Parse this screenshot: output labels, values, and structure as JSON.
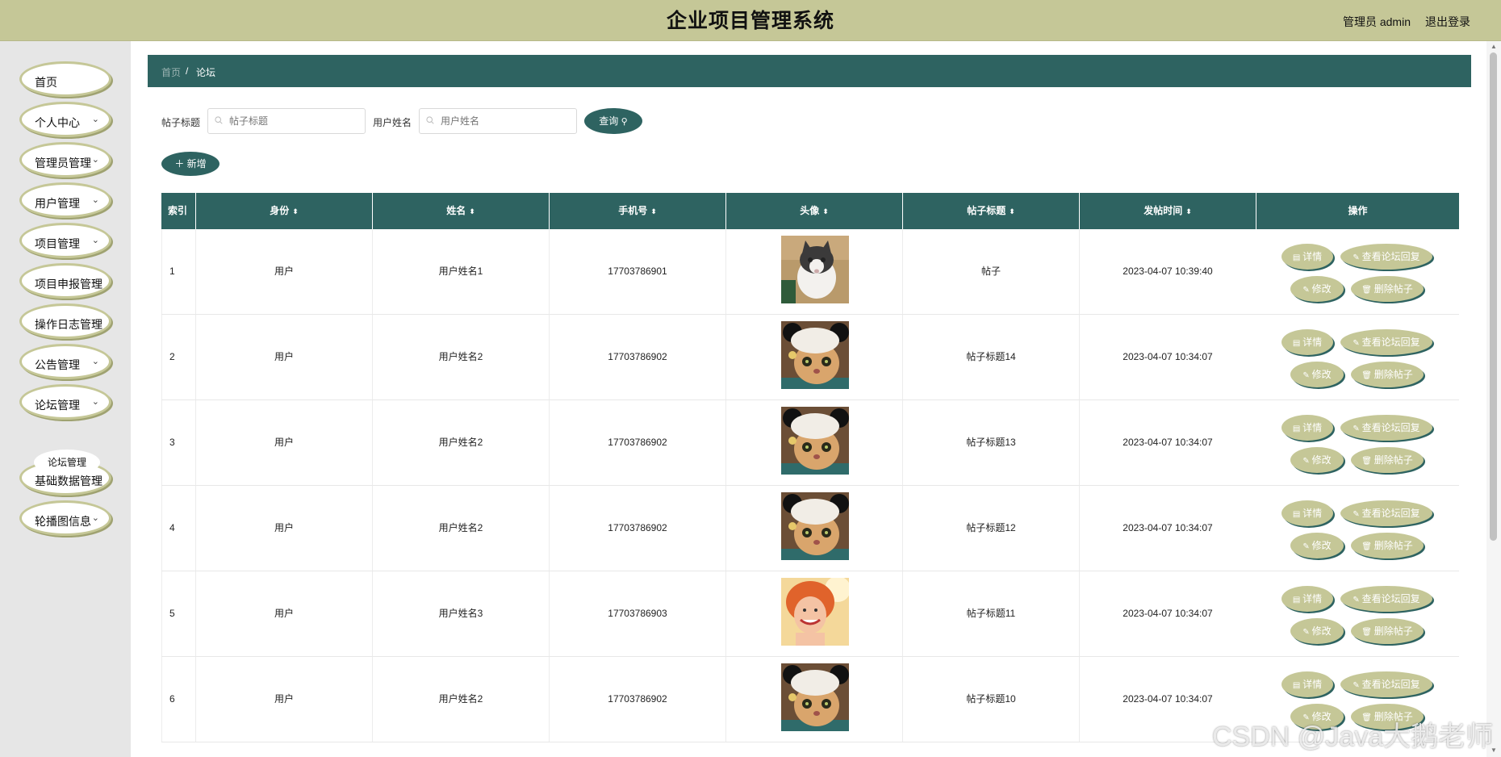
{
  "header": {
    "title": "企业项目管理系统",
    "user_label": "管理员 admin",
    "logout_label": "退出登录",
    "accent": "#c5c797",
    "brand": "#2e6361"
  },
  "sidebar": {
    "items": [
      {
        "label": "首页",
        "expandable": false
      },
      {
        "label": "个人中心",
        "expandable": true
      },
      {
        "label": "管理员管理",
        "expandable": true
      },
      {
        "label": "用户管理",
        "expandable": true
      },
      {
        "label": "项目管理",
        "expandable": true
      },
      {
        "label": "项目申报管理",
        "expandable": true
      },
      {
        "label": "操作日志管理",
        "expandable": true
      },
      {
        "label": "公告管理",
        "expandable": true
      },
      {
        "label": "论坛管理",
        "expandable": true
      },
      {
        "label": "基础数据管理",
        "expandable": true
      },
      {
        "label": "轮播图信息",
        "expandable": true
      }
    ],
    "submenu": {
      "label": "论坛管理"
    }
  },
  "breadcrumb": {
    "home": "首页",
    "separator": "/",
    "current": "论坛"
  },
  "filters": {
    "title_label": "帖子标题",
    "title_placeholder": "帖子标题",
    "user_label": "用户姓名",
    "user_placeholder": "用户姓名",
    "query_button": "查询"
  },
  "toolbar": {
    "add_button": "新增"
  },
  "table": {
    "columns": [
      "索引",
      "身份",
      "姓名",
      "手机号",
      "头像",
      "帖子标题",
      "发帖时间",
      "操作"
    ],
    "rows": [
      {
        "index": "1",
        "role": "用户",
        "name": "用户姓名1",
        "phone": "17703786901",
        "avatar": "cat-photo",
        "title": "帖子",
        "time": "2023-04-07 10:39:40"
      },
      {
        "index": "2",
        "role": "用户",
        "name": "用户姓名2",
        "phone": "17703786902",
        "avatar": "cat-hat-photo",
        "title": "帖子标题14",
        "time": "2023-04-07 10:34:07"
      },
      {
        "index": "3",
        "role": "用户",
        "name": "用户姓名2",
        "phone": "17703786902",
        "avatar": "cat-hat-photo",
        "title": "帖子标题13",
        "time": "2023-04-07 10:34:07"
      },
      {
        "index": "4",
        "role": "用户",
        "name": "用户姓名2",
        "phone": "17703786902",
        "avatar": "cat-hat-photo",
        "title": "帖子标题12",
        "time": "2023-04-07 10:34:07"
      },
      {
        "index": "5",
        "role": "用户",
        "name": "用户姓名3",
        "phone": "17703786903",
        "avatar": "woman-photo",
        "title": "帖子标题11",
        "time": "2023-04-07 10:34:07"
      },
      {
        "index": "6",
        "role": "用户",
        "name": "用户姓名2",
        "phone": "17703786902",
        "avatar": "cat-hat-photo",
        "title": "帖子标题10",
        "time": "2023-04-07 10:34:07"
      }
    ],
    "actions": {
      "detail": "详情",
      "view_replies": "查看论坛回复",
      "edit": "修改",
      "delete": "删除帖子"
    }
  },
  "watermark": "CSDN @Java大鹅老师"
}
